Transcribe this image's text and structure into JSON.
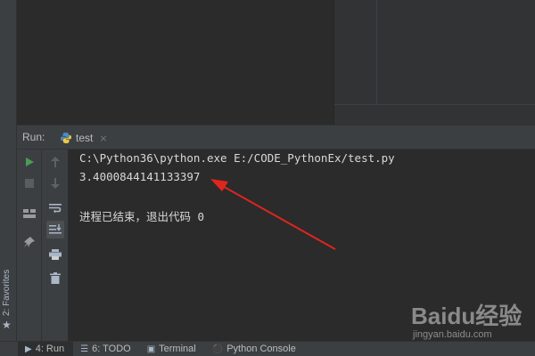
{
  "run_panel": {
    "title": "Run:",
    "tab_label": "test",
    "tab_close": "×"
  },
  "console": {
    "lines": [
      "C:\\Python36\\python.exe E:/CODE_PythonEx/test.py",
      "3.4000844141133397",
      "",
      "进程已结束，退出代码 0"
    ]
  },
  "left_strip": {
    "favorites_label": "2: Favorites"
  },
  "bottom_tabs": [
    {
      "label": "4: Run",
      "icon": "play-icon"
    },
    {
      "label": "6: TODO",
      "icon": "todo-icon"
    },
    {
      "label": "Terminal",
      "icon": "terminal-icon"
    },
    {
      "label": "Python Console",
      "icon": "python-console-icon"
    }
  ],
  "watermark": {
    "brand": "Baidu经验",
    "url": "jingyan.baidu.com"
  },
  "colors": {
    "run_green": "#499c54",
    "arrow_red": "#e0251f",
    "console_bg": "#2b2b2b",
    "panel_bg": "#3c3f41"
  }
}
